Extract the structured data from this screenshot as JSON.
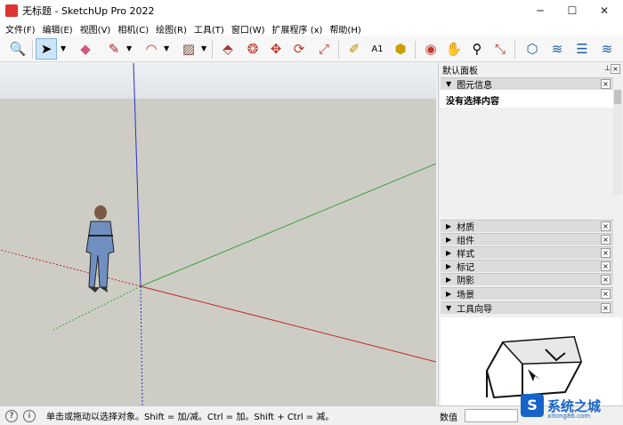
{
  "window": {
    "title": "无标题 - SketchUp Pro 2022",
    "minimize": "─",
    "maximize": "☐",
    "close": "✕"
  },
  "menu": [
    "文件(F)",
    "编辑(E)",
    "视图(V)",
    "相机(C)",
    "绘图(R)",
    "工具(T)",
    "窗口(W)",
    "扩展程序 (x)",
    "帮助(H)"
  ],
  "toolbar_icons": [
    "zoom-extents-icon",
    "select-icon",
    "eraser-icon",
    "pencil-icon",
    "arc-icon",
    "rectangle-icon",
    "push-pull-icon",
    "follow-me-icon",
    "move-icon",
    "rotate-icon",
    "scale-icon",
    "tape-measure-icon",
    "text-icon",
    "paint-bucket-icon",
    "orbit-icon",
    "pan-icon",
    "zoom-icon",
    "zoom-window-icon",
    "components-icon",
    "extension-warehouse-icon",
    "layout-icon",
    "extension-manager-icon"
  ],
  "panel": {
    "title": "默认面板",
    "pin": "⊥",
    "entity_info": {
      "title": "图元信息",
      "content": "没有选择内容"
    },
    "trays": [
      {
        "label": "材质",
        "expanded": false
      },
      {
        "label": "组件",
        "expanded": false
      },
      {
        "label": "样式",
        "expanded": false
      },
      {
        "label": "标记",
        "expanded": false
      },
      {
        "label": "阴影",
        "expanded": false
      },
      {
        "label": "场景",
        "expanded": false
      },
      {
        "label": "工具向导",
        "expanded": true
      }
    ],
    "close": "×",
    "collapsed_arrow": "▶",
    "expanded_arrow": "▼"
  },
  "status": {
    "hint": "单击或拖动以选择对象。Shift = 加/减。Ctrl = 加。Shift + Ctrl = 减。",
    "geo_icon": "?",
    "info_icon": "i",
    "measurements_label": "数值"
  },
  "watermark": {
    "text": "系统之城",
    "url": "xitong86.com",
    "logo": "S"
  },
  "colors": {
    "red_axis": "#c42b1c",
    "green_axis": "#3ca33c",
    "blue_axis": "#2e2ec8",
    "ground": "#cdcdc6",
    "sky": "#e8ecef"
  }
}
